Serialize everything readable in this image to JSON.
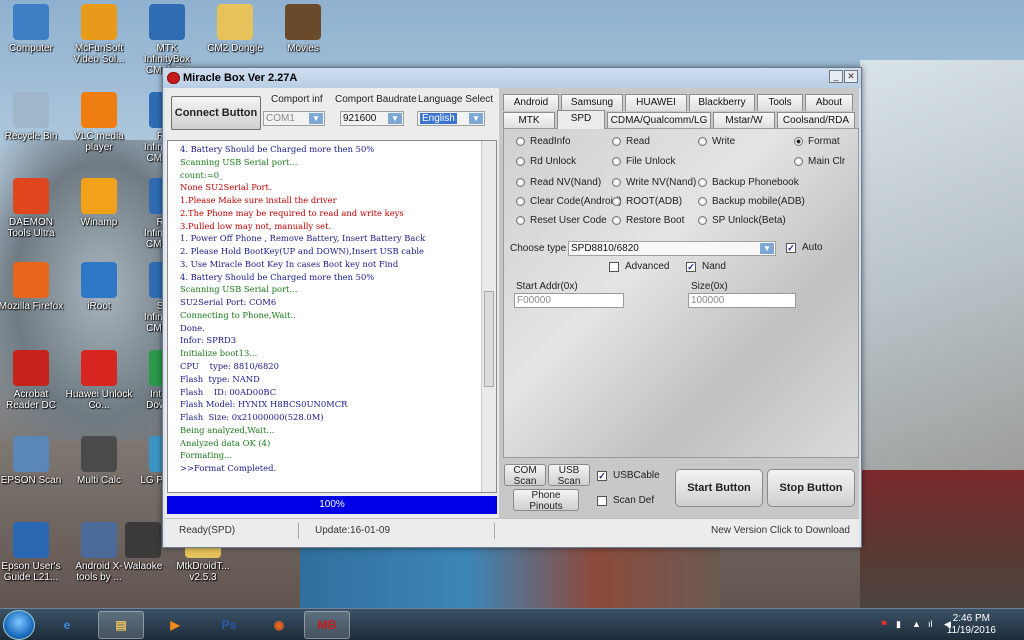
{
  "desktop_icons": [
    {
      "name": "Computer",
      "icon": "computer-icon",
      "color": "#3d7ec4"
    },
    {
      "name": "McFunSoft Video Sol...",
      "icon": "mcfunsoft-icon",
      "color": "#e89a1b"
    },
    {
      "name": "MTK InfinityBox CM2MTK",
      "icon": "mtk-icon",
      "color": "#2e6db4"
    },
    {
      "name": "CM2 Dongle",
      "icon": "folder-icon",
      "color": "#e5c35a"
    },
    {
      "name": "Movies",
      "icon": "movies-icon",
      "color": "#6a4a2a"
    },
    {
      "name": "Recycle Bin",
      "icon": "recycle-bin-icon",
      "color": "#9fb7c9"
    },
    {
      "name": "VLC media player",
      "icon": "vlc-icon",
      "color": "#f07d12"
    },
    {
      "name": "RKT InfinityBox CM2RKT",
      "icon": "rkt-icon",
      "color": "#2e6db4"
    },
    {
      "name": "DAEMON Tools Ultra",
      "icon": "daemon-tools-icon",
      "color": "#e0461e"
    },
    {
      "name": "Winamp",
      "icon": "winamp-icon",
      "color": "#f2a21a"
    },
    {
      "name": "RDA InfinityBox CM2RDA",
      "icon": "rda-icon",
      "color": "#2e6db4"
    },
    {
      "name": "Mozilla Firefox",
      "icon": "firefox-icon",
      "color": "#e8661c"
    },
    {
      "name": "iRoot",
      "icon": "iroot-icon",
      "color": "#2f78c8"
    },
    {
      "name": "SPD InfinityBox CM2SPD",
      "icon": "spd-icon",
      "color": "#2e6db4"
    },
    {
      "name": "Acrobat Reader DC",
      "icon": "acrobat-icon",
      "color": "#c7231d"
    },
    {
      "name": "Huawei Unlock Co...",
      "icon": "huawei-icon",
      "color": "#d6261f"
    },
    {
      "name": "Internet Downlo...",
      "icon": "idm-icon",
      "color": "#2a9a4a"
    },
    {
      "name": "EPSON Scan",
      "icon": "epson-scan-icon",
      "color": "#5a86b8"
    },
    {
      "name": "Multi Calc",
      "icon": "multi-calc-icon",
      "color": "#4a4a4a"
    },
    {
      "name": "LG PC Su...",
      "icon": "lg-pc-suite-icon",
      "color": "#3b94c5"
    },
    {
      "name": "Epson User's Guide L21...",
      "icon": "epson-guide-icon",
      "color": "#2a68b4"
    },
    {
      "name": "Android X-tools by ...",
      "icon": "android-xtools-icon",
      "color": "#4a6a9a"
    },
    {
      "name": "Walaoke",
      "icon": "walaoke-icon",
      "color": "#3a3a3a"
    },
    {
      "name": "MtkDroidT... v2.5.3",
      "icon": "folder-icon",
      "color": "#e5c35a"
    }
  ],
  "window": {
    "title": "Miracle Box Ver 2.27A",
    "connect_button": "Connect Button",
    "comport_label": "Comport inf",
    "comport_value": "COM1",
    "baud_label": "Comport Baudrate",
    "baud_value": "921600",
    "lang_label": "Language Select",
    "lang_value": "English",
    "log": [
      {
        "t": "4. Battery Should be Charged more then 50%",
        "c": "#1a1a8a"
      },
      {
        "t": "Scanning USB Serial port...",
        "c": "#1a7a1a"
      },
      {
        "t": "count:=0_",
        "c": "#1a7a1a"
      },
      {
        "t": "None SU2Serial Port.",
        "c": "#c00000"
      },
      {
        "t": "1.Please Make sure install the driver",
        "c": "#c00000"
      },
      {
        "t": "2.The Phone may be required to read and write keys",
        "c": "#c00000"
      },
      {
        "t": "3.Pulled low may not, manually set.",
        "c": "#c00000"
      },
      {
        "t": "1. Power Off Phone , Remove Battery, Insert Battery Back",
        "c": "#1a1a8a"
      },
      {
        "t": "2. Please Hold BootKey(UP and DOWN),Insert USB cable",
        "c": "#1a1a8a"
      },
      {
        "t": "3. Use Miracle Boot Key In cases Boot key not Find",
        "c": "#1a1a8a"
      },
      {
        "t": "4. Battery Should be Charged more then 50%",
        "c": "#1a1a8a"
      },
      {
        "t": "Scanning USB Serial port...",
        "c": "#1a7a1a"
      },
      {
        "t": "SU2Serial Port: COM6",
        "c": "#1a1a8a"
      },
      {
        "t": "Connecting to Phone,Wait..",
        "c": "#1a7a1a"
      },
      {
        "t": "Done.",
        "c": "#1a1a8a"
      },
      {
        "t": "Infor: SPRD3",
        "c": "#1a1a8a"
      },
      {
        "t": "Initialize boot13...",
        "c": "#1a7a1a"
      },
      {
        "t": "CPU    type: 8810/6820",
        "c": "#1a1a8a"
      },
      {
        "t": "Flash  type: NAND",
        "c": "#1a1a8a"
      },
      {
        "t": "Flash    ID: 00AD00BC",
        "c": "#1a1a8a"
      },
      {
        "t": "Flash Model: HYNIX H8BCS0UN0MCR",
        "c": "#1a1a8a"
      },
      {
        "t": "Flash  Size: 0x21000000(528.0M)",
        "c": "#1a1a8a"
      },
      {
        "t": "Being analyzed,Wait...",
        "c": "#1a7a1a"
      },
      {
        "t": "Analyzed data OK (4)",
        "c": "#1a7a1a"
      },
      {
        "t": "Formating...",
        "c": "#1a7a1a"
      },
      {
        "t": ">>Format Completed.",
        "c": "#1a1a8a"
      }
    ],
    "progress_text": "100%",
    "progress_fraction": 1.0,
    "status_ready": "Ready(SPD)",
    "status_update": "Update:16-01-09",
    "status_new": "New Version Click to Download",
    "tabs_row1": [
      "Android",
      "Samsung",
      "HUAWEI",
      "Blackberry",
      "Tools",
      "About"
    ],
    "tabs_row2": [
      "MTK",
      "SPD",
      "CDMA/Qualcomm/LG",
      "Mstar/W",
      "Coolsand/RDA"
    ],
    "active_tab": "SPD",
    "radios": [
      {
        "label": "ReadInfo",
        "on": false
      },
      {
        "label": "Read",
        "on": false
      },
      {
        "label": "Write",
        "on": false
      },
      {
        "label": "Format",
        "on": true
      },
      {
        "label": "Rd Unlock",
        "on": false
      },
      {
        "label": "File Unlock",
        "on": false
      },
      {
        "label": "Main Clr",
        "on": false
      },
      {
        "label": "Read NV(Nand)",
        "on": false
      },
      {
        "label": "Write NV(Nand)",
        "on": false
      },
      {
        "label": "Backup Phonebook",
        "on": false
      },
      {
        "label": "Clear Code(Android)",
        "on": false
      },
      {
        "label": "ROOT(ADB)",
        "on": false
      },
      {
        "label": "Backup mobile(ADB)",
        "on": false
      },
      {
        "label": "Reset User Code",
        "on": false
      },
      {
        "label": "Restore Boot",
        "on": false
      },
      {
        "label": "SP Unlock(Beta)",
        "on": false
      }
    ],
    "choose_type_label": "Choose  type",
    "choose_type_value": "SPD8810/6820",
    "auto_label": "Auto",
    "advanced_label": "Advanced",
    "nand_label": "Nand",
    "start_addr_label": "Start Addr(0x)",
    "start_addr_value": "F00000",
    "size_label": "Size(0x)",
    "size_value": "100000",
    "com_scan": "COM Scan",
    "usb_scan": "USB Scan",
    "usbcable_label": "USBCable",
    "phone_pinouts": "Phone Pinouts",
    "scan_def_label": "Scan Def",
    "start_button": "Start Button",
    "stop_button": "Stop Button"
  },
  "taskbar": {
    "items": [
      {
        "icon": "ie-icon",
        "label": "e",
        "color": "#3b8ad6"
      },
      {
        "icon": "explorer-icon",
        "label": "▤",
        "color": "#e8c15a"
      },
      {
        "icon": "media-player-icon",
        "label": "▶",
        "color": "#f08a1a"
      },
      {
        "icon": "photoshop-icon",
        "label": "Ps",
        "color": "#2a5ba8"
      },
      {
        "icon": "firefox-icon",
        "label": "◉",
        "color": "#e8661c"
      },
      {
        "icon": "miracle-box-icon",
        "label": "MB",
        "color": "#c61b1b"
      }
    ],
    "time": "2:46 PM",
    "date": "11/19/2016"
  }
}
